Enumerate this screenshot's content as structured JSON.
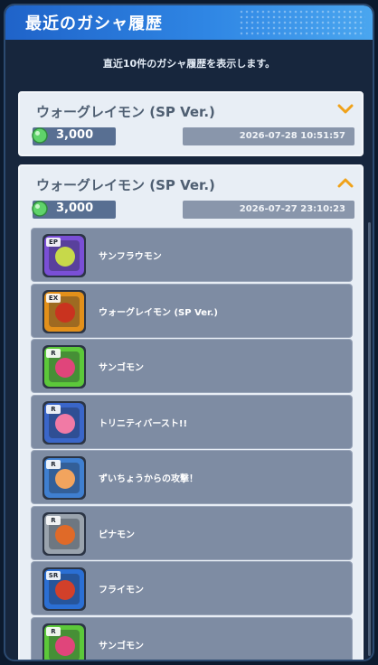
{
  "window": {
    "title": "最近のガシャ履歴",
    "subtitle": "直近10件のガシャ履歴を表示します。"
  },
  "history": [
    {
      "name": "ウォーグレイモン (SP Ver.)",
      "cost": "3,000",
      "date": "2026-07-28 10:51:57",
      "expanded": false
    },
    {
      "name": "ウォーグレイモン (SP Ver.)",
      "cost": "3,000",
      "date": "2026-07-27 23:10:23",
      "expanded": true,
      "items": [
        {
          "label": "サンフラウモン",
          "badge": "EP",
          "frame": "#7a4fd6",
          "accent": "#c7d94a"
        },
        {
          "label": "ウォーグレイモン (SP Ver.)",
          "badge": "EX",
          "frame": "#e3901a",
          "accent": "#c9331f"
        },
        {
          "label": "サンゴモン",
          "badge": "R",
          "frame": "#5cc83a",
          "accent": "#e0457b"
        },
        {
          "label": "トリニティバースト!!",
          "badge": "R",
          "frame": "#3a66c9",
          "accent": "#f17aa5"
        },
        {
          "label": "ずいちょうからの攻撃！",
          "badge": "R",
          "frame": "#3f7fd0",
          "accent": "#f2a45e"
        },
        {
          "label": "ピナモン",
          "badge": "R",
          "frame": "#9aa3ad",
          "accent": "#e06a28"
        },
        {
          "label": "フライモン",
          "badge": "SR",
          "frame": "#2b6fd4",
          "accent": "#d2402a"
        },
        {
          "label": "サンゴモン",
          "badge": "R",
          "frame": "#5cc83a",
          "accent": "#e0457b"
        }
      ]
    }
  ],
  "colors": {
    "title_bar": "#2f86e4",
    "card": "#e8eef5",
    "item": "#7e8ca3",
    "chevron": "#f0a21a",
    "gem": "#5fd36a"
  }
}
